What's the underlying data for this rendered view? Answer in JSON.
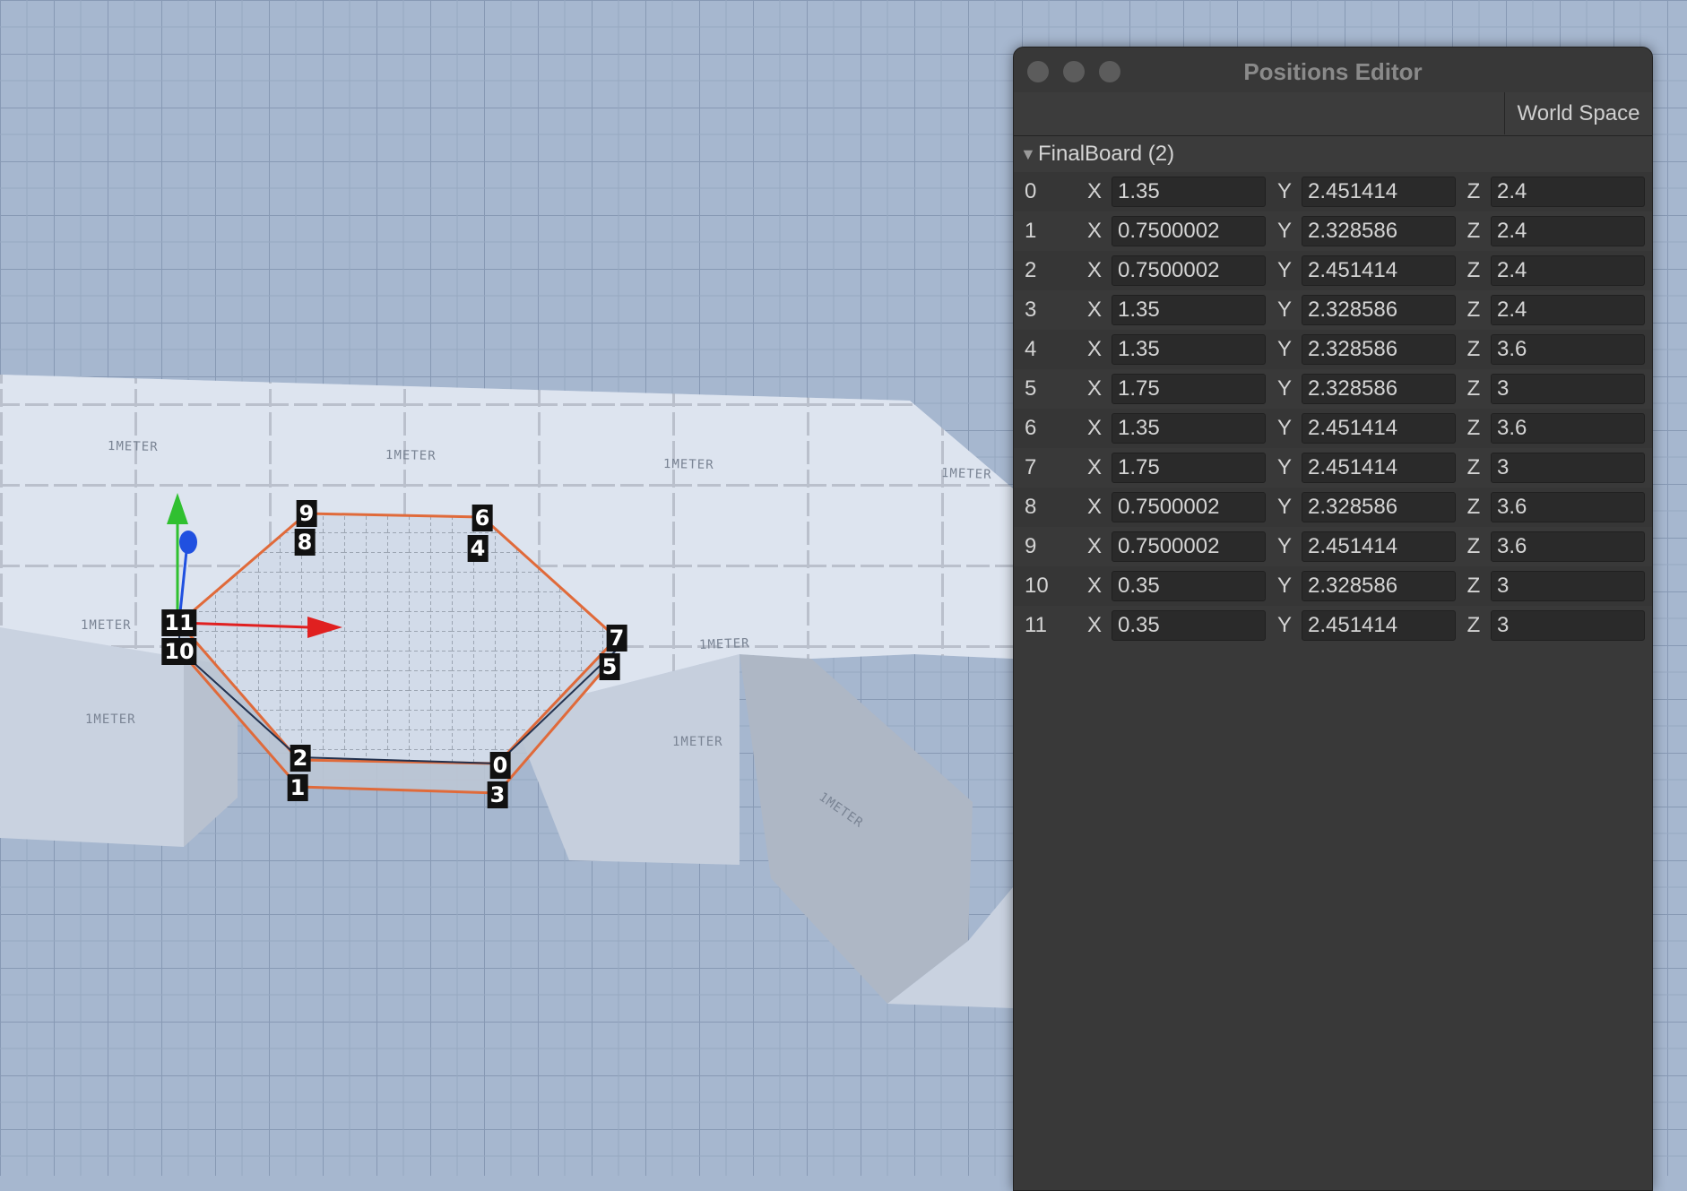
{
  "window": {
    "title": "Positions Editor"
  },
  "toolbar": {
    "space_mode": "World Space"
  },
  "group": {
    "name": "FinalBoard (2)"
  },
  "axis_labels": {
    "x": "X",
    "y": "Y",
    "z": "Z"
  },
  "vertices": [
    {
      "index": "0",
      "x": "1.35",
      "y": "2.451414",
      "z": "2.4"
    },
    {
      "index": "1",
      "x": "0.7500002",
      "y": "2.328586",
      "z": "2.4"
    },
    {
      "index": "2",
      "x": "0.7500002",
      "y": "2.451414",
      "z": "2.4"
    },
    {
      "index": "3",
      "x": "1.35",
      "y": "2.328586",
      "z": "2.4"
    },
    {
      "index": "4",
      "x": "1.35",
      "y": "2.328586",
      "z": "3.6"
    },
    {
      "index": "5",
      "x": "1.75",
      "y": "2.328586",
      "z": "3"
    },
    {
      "index": "6",
      "x": "1.35",
      "y": "2.451414",
      "z": "3.6"
    },
    {
      "index": "7",
      "x": "1.75",
      "y": "2.451414",
      "z": "3"
    },
    {
      "index": "8",
      "x": "0.7500002",
      "y": "2.328586",
      "z": "3.6"
    },
    {
      "index": "9",
      "x": "0.7500002",
      "y": "2.451414",
      "z": "3.6"
    },
    {
      "index": "10",
      "x": "0.35",
      "y": "2.328586",
      "z": "3"
    },
    {
      "index": "11",
      "x": "0.35",
      "y": "2.451414",
      "z": "3"
    }
  ],
  "scene": {
    "vertex_labels": [
      "9",
      "8",
      "6",
      "4",
      "7",
      "5",
      "11",
      "10",
      "2",
      "1",
      "0",
      "3"
    ],
    "meter_label": "1METER",
    "colors": {
      "floor": "#a6b7cf",
      "board": "#dbe2ee",
      "edge": "#e06a3a",
      "gizmo_x": "#e02020",
      "gizmo_y": "#30c030",
      "gizmo_z": "#2050e0"
    }
  }
}
